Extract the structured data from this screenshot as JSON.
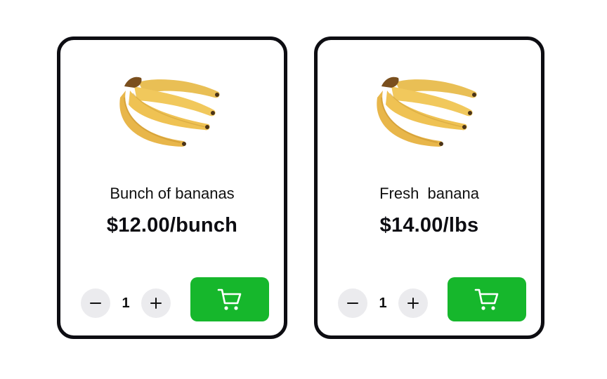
{
  "theme": {
    "accent": "#16b72c",
    "card_border": "#0d0d12",
    "stepper_bg": "#ebebee"
  },
  "products": [
    {
      "name": "Bunch of bananas",
      "price": "$12.00/bunch",
      "quantity": "1",
      "image_icon": "banana-bunch-image",
      "decrement_icon": "minus-icon",
      "increment_icon": "plus-icon",
      "cart_icon": "shopping-cart-icon"
    },
    {
      "name": "Fresh  banana",
      "price": "$14.00/lbs",
      "quantity": "1",
      "image_icon": "banana-bunch-image",
      "decrement_icon": "minus-icon",
      "increment_icon": "plus-icon",
      "cart_icon": "shopping-cart-icon"
    }
  ]
}
